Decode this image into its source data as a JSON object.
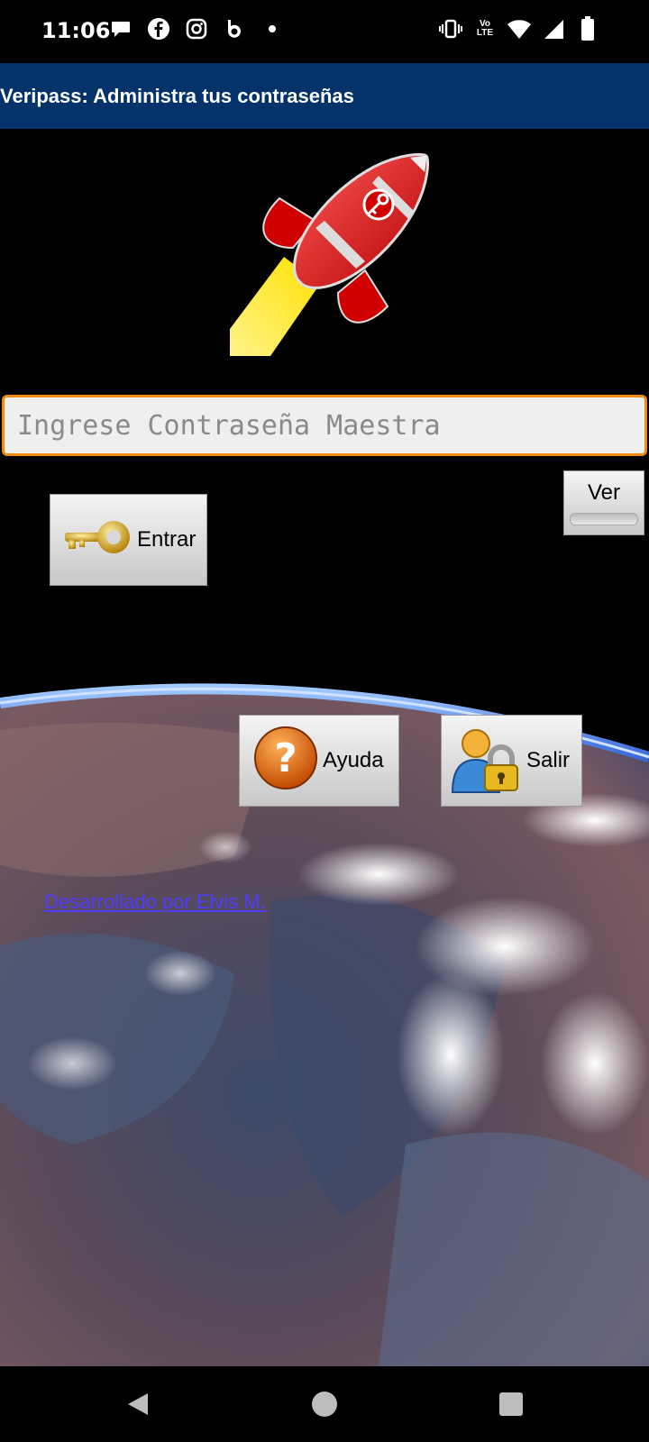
{
  "status_bar": {
    "time": "11:06",
    "left_icons": [
      "chat-bubble-icon",
      "facebook-icon",
      "instagram-icon",
      "beats-icon",
      "dot-icon"
    ],
    "right_icons": [
      "vibrate-icon",
      "volte-icon",
      "wifi-icon",
      "cell-signal-icon",
      "battery-icon"
    ],
    "volte_text_top": "Vo",
    "volte_text_bottom": "LTE"
  },
  "app_bar": {
    "title": "Veripass: Administra tus contraseñas",
    "background": "#04326a"
  },
  "login": {
    "password_placeholder": "Ingrese Contraseña Maestra",
    "password_value": "",
    "show_button_label": "Ver",
    "enter_button_label": "Entrar",
    "accent_color": "#f08a12"
  },
  "actions": {
    "help_label": "Ayuda",
    "exit_label": "Salir"
  },
  "footer": {
    "developer_link": "Desarrollado por Elvis M."
  },
  "nav_bar": {
    "icons": [
      "back-icon",
      "home-icon",
      "recents-icon"
    ]
  }
}
